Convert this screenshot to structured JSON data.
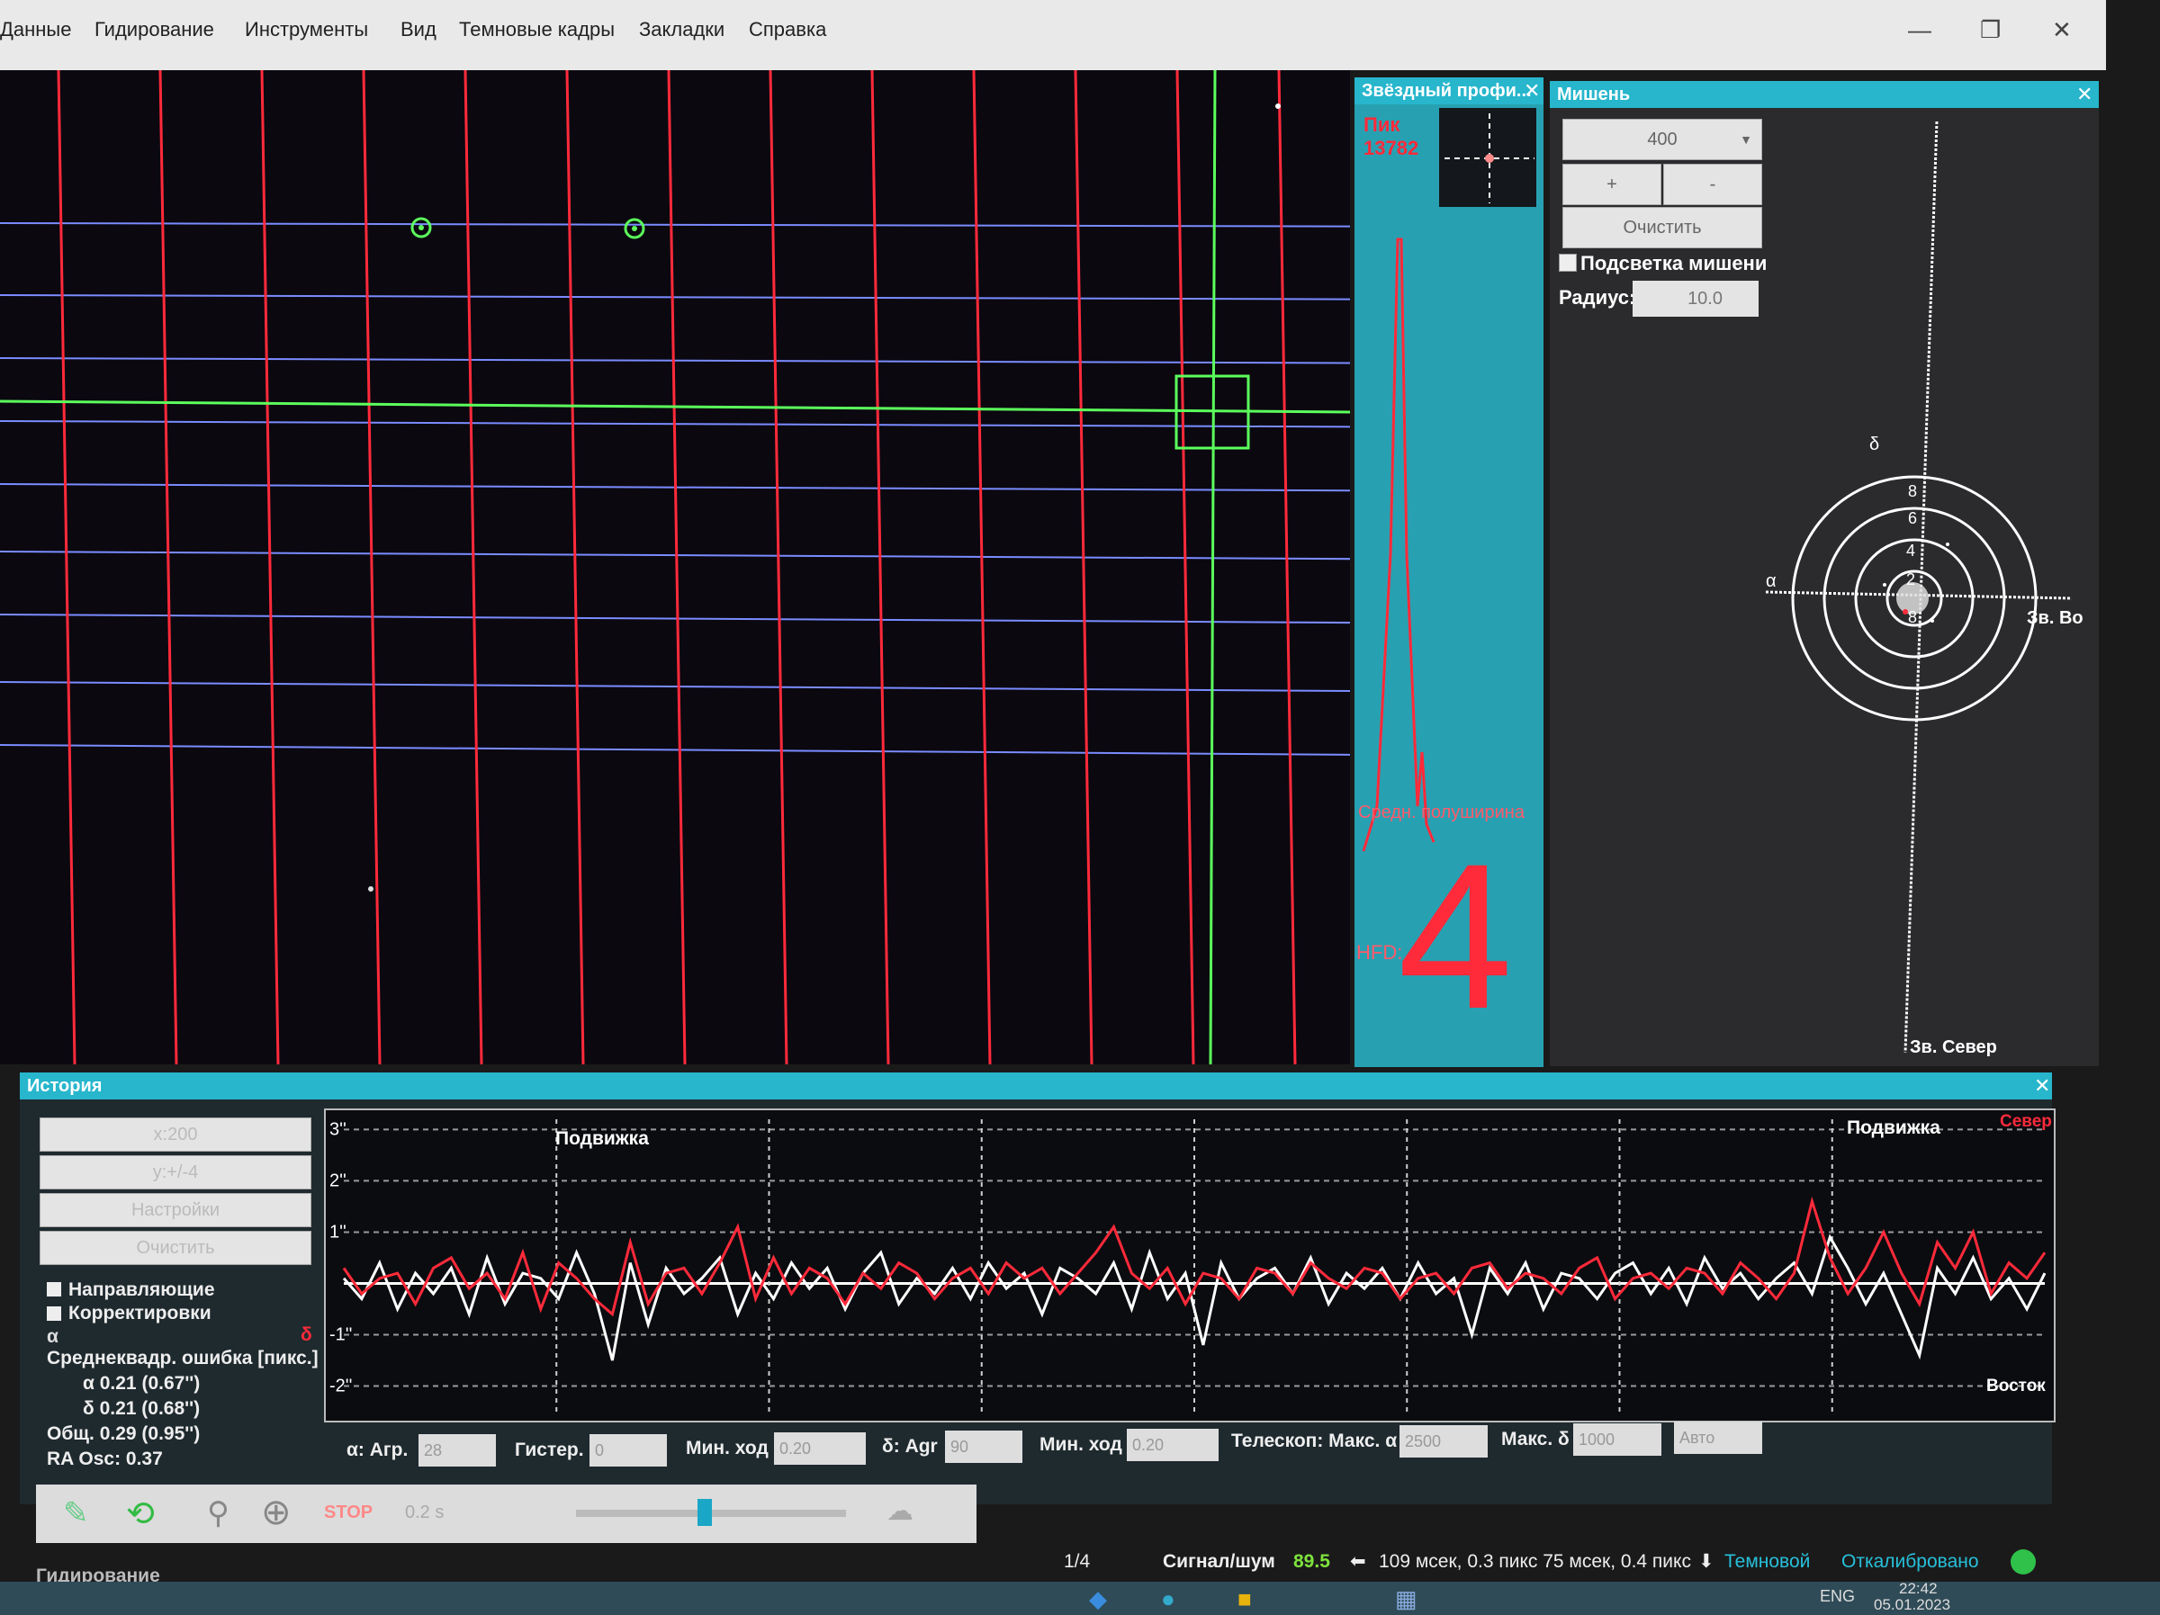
{
  "menu": {
    "items": [
      "Данные",
      "Гидирование",
      "Инструменты",
      "Вид",
      "Темновые кадры",
      "Закладки",
      "Справка"
    ],
    "window_controls": [
      "—",
      "❐",
      "✕"
    ]
  },
  "profile": {
    "title": "Звёздный профи...",
    "close": "✕",
    "peak_label": "Пик",
    "peak_value": "13782",
    "fwhm_label": "Средн. полуширина",
    "hfd_label": "HFD:",
    "hfd_value": "4",
    "color": "#ff2a3a"
  },
  "target": {
    "title": "Мишень",
    "close": "✕",
    "scale_select": "400",
    "plus": "+",
    "minus": "-",
    "clear": "Очистить",
    "highlight_label": "Подсветка мишени",
    "radius_label": "Радиус:",
    "radius_value": "10.0",
    "axis_alpha": "α",
    "axis_delta": "δ",
    "east_label": "Зв. Во",
    "north_label": "Зв. Север",
    "ring_labels": [
      "8",
      "6",
      "4",
      "2"
    ]
  },
  "history": {
    "title": "История",
    "close": "✕",
    "scale_select": "x:200",
    "units_select": "y:+/-4",
    "settings_select": "Настройки",
    "clear": "Очистить",
    "check_guides": "Направляющие",
    "check_corrections": "Корректировки",
    "alpha_marker": "α",
    "delta_marker": "δ",
    "rms_title": "Среднеквадр. ошибка [пикс.]",
    "rms_alpha": "α 0.21 (0.67'')",
    "rms_delta": "δ 0.21 (0.68'')",
    "rms_total": "Общ. 0.29 (0.95'')",
    "ra_osc": "RA Osc: 0.37",
    "plot_label_dither_1": "Подвижка",
    "plot_label_dither_2": "Подвижка",
    "plot_label_north": "Север",
    "plot_label_east": "Восток",
    "y_ticks": [
      "3''",
      "2''",
      "1''",
      "",
      "-1''",
      "-2''"
    ]
  },
  "controls": {
    "ra_agr_label": "α: Агр.",
    "ra_agr_value": "28",
    "hyst_label": "Гистер.",
    "hyst_value": "0",
    "min_move_label": "Мин. ход",
    "min_move_value": "0.20",
    "dec_agr_label": "δ: Agr",
    "dec_agr_value": "90",
    "min_move2_label": "Мин. ход",
    "min_move2_value": "0.20",
    "scope_label": "Телескоп: Макс. α",
    "max_ra_value": "2500",
    "max_dec_label": "Макс. δ",
    "max_dec_value": "1000",
    "auto_value": "Авто"
  },
  "toolbar": {
    "exposure": "0.2 s",
    "stop": "STOP"
  },
  "status": {
    "mode": "Гидирование",
    "frame": "1/4",
    "snr_label": "Сигнал/шум",
    "snr_value": "89.5",
    "guide_info": "109 мсек, 0.3 пикс 75 мсек, 0.4 пикс",
    "dark": "Темновой",
    "calibrated": "Откалибровано"
  },
  "tray": {
    "lang": "ENG",
    "time": "22:42",
    "date": "05.01.2023"
  },
  "chart_data": {
    "type": "line",
    "series": [
      {
        "name": "α",
        "color": "#ffffff",
        "values": [
          0.1,
          -0.3,
          0.4,
          -0.5,
          0.2,
          -0.2,
          0.3,
          -0.6,
          0.5,
          -0.4,
          0.2,
          0.1,
          -0.3,
          0.6,
          -0.2,
          -1.5,
          0.4,
          -0.8,
          0.3,
          -0.2,
          0.1,
          0.5,
          -0.6,
          0.2,
          -0.3,
          0.4,
          -0.1,
          0.3,
          -0.5,
          0.2,
          0.6,
          -0.4,
          0.1,
          -0.2,
          0.3,
          -0.3,
          0.4,
          -0.1,
          0.2,
          -0.6,
          0.3,
          0.1,
          -0.2,
          0.4,
          -0.5,
          0.6,
          -0.3,
          0.2,
          -1.2,
          0.4,
          -0.3,
          0.1,
          0.3,
          -0.2,
          0.5,
          -0.4,
          0.2,
          -0.1,
          0.3,
          -0.3,
          0.4,
          -0.2,
          0.1,
          -1.0,
          0.3,
          -0.2,
          0.4,
          -0.5,
          0.2,
          0.1,
          -0.3,
          0.2,
          0.4,
          -0.2,
          0.3,
          -0.4,
          0.5,
          -0.1,
          0.2,
          -0.3,
          0.1,
          0.4,
          -0.2,
          0.9,
          0.3,
          -0.4,
          0.2,
          -0.6,
          -1.4,
          0.3,
          -0.2,
          0.5,
          -0.3,
          0.1,
          -0.5,
          0.2
        ]
      },
      {
        "name": "δ",
        "color": "#ff2a3a",
        "values": [
          0.3,
          -0.2,
          0.1,
          0.2,
          -0.4,
          0.3,
          0.5,
          -0.1,
          0.2,
          -0.3,
          0.6,
          -0.5,
          0.4,
          0.1,
          -0.3,
          -0.6,
          0.8,
          -0.4,
          0.2,
          0.3,
          -0.2,
          0.4,
          1.1,
          -0.3,
          0.5,
          -0.2,
          0.3,
          0.1,
          -0.4,
          0.2,
          -0.1,
          0.4,
          0.2,
          -0.3,
          0.1,
          0.3,
          -0.2,
          0.4,
          0.1,
          0.3,
          -0.2,
          0.2,
          0.6,
          1.1,
          0.2,
          -0.1,
          0.3,
          -0.4,
          0.2,
          0.1,
          -0.3,
          0.3,
          0.2,
          -0.2,
          0.4,
          0.1,
          -0.1,
          0.3,
          0.2,
          -0.3,
          0.1,
          0.2,
          -0.2,
          0.3,
          0.4,
          -0.1,
          0.2,
          0.1,
          -0.2,
          0.3,
          0.5,
          -0.3,
          0.1,
          0.2,
          -0.1,
          0.3,
          0.2,
          -0.2,
          0.4,
          0.1,
          -0.3,
          0.2,
          1.6,
          0.5,
          -0.2,
          0.3,
          1.0,
          0.2,
          -0.4,
          0.8,
          0.3,
          1.0,
          -0.2,
          0.4,
          0.1,
          0.6
        ]
      }
    ],
    "ylim": [
      -2.5,
      3.2
    ],
    "grid": true
  }
}
